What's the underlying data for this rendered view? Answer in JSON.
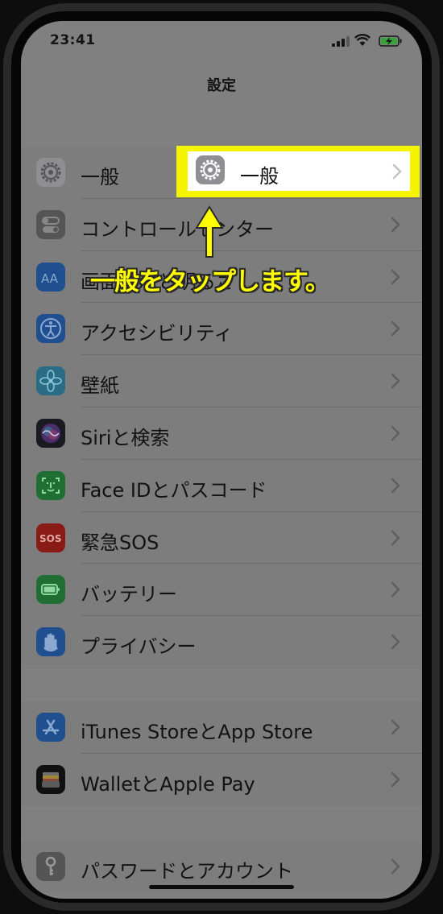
{
  "status_bar": {
    "time": "23:41",
    "icons": [
      "signal-icon",
      "wifi-icon",
      "battery-charging-icon"
    ]
  },
  "nav": {
    "title": "設定"
  },
  "groups": [
    {
      "items": [
        {
          "label": "一般",
          "icon": "gear-icon",
          "color": "#8e8e93"
        },
        {
          "label": "コントロールセンター",
          "icon": "toggles-icon",
          "color": "#8e8e93"
        },
        {
          "label": "画面表示と明るさ",
          "icon": "text-size-icon",
          "color": "#0a84ff"
        },
        {
          "label": "アクセシビリティ",
          "icon": "accessibility-icon",
          "color": "#0a84ff"
        },
        {
          "label": "壁紙",
          "icon": "flower-icon",
          "color": "#32ade6"
        },
        {
          "label": "Siriと検索",
          "icon": "siri-icon",
          "color": "#222222"
        },
        {
          "label": "Face IDとパスコード",
          "icon": "face-id-icon",
          "color": "#30d158"
        },
        {
          "label": "緊急SOS",
          "icon": "sos-icon",
          "color": "#ff3b30"
        },
        {
          "label": "バッテリー",
          "icon": "battery-icon",
          "color": "#30d158"
        },
        {
          "label": "プライバシー",
          "icon": "hand-icon",
          "color": "#0a84ff"
        }
      ]
    },
    {
      "items": [
        {
          "label": "iTunes StoreとApp Store",
          "icon": "app-store-icon",
          "color": "#0a84ff"
        },
        {
          "label": "WalletとApple Pay",
          "icon": "wallet-icon",
          "color": "#111111"
        }
      ]
    },
    {
      "items": [
        {
          "label": "パスワードとアカウント",
          "icon": "key-icon",
          "color": "#8e8e93"
        }
      ]
    }
  ],
  "annotation": {
    "text": "一般をタップします。",
    "highlight_color": "#f4f400",
    "text_color": "#ffff00"
  }
}
